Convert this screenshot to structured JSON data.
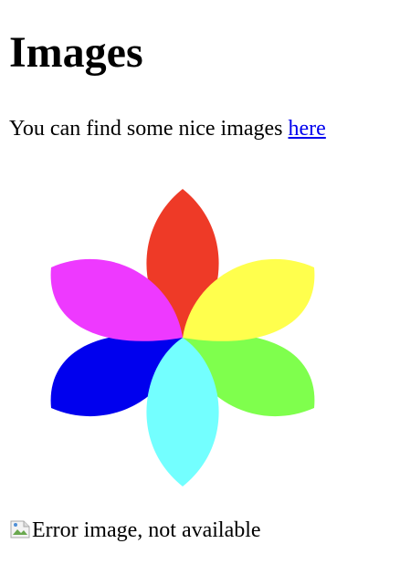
{
  "page": {
    "heading": "Images",
    "intro_text": "You can find some nice images ",
    "link_text": "here",
    "image_alt": "Error image, not available"
  },
  "flower": {
    "colors": {
      "red": "#ee3a27",
      "yellow": "#ffff4d",
      "green": "#7fff4d",
      "cyan": "#73ffff",
      "blue": "#0000ee",
      "magenta": "#ee39ff"
    }
  }
}
